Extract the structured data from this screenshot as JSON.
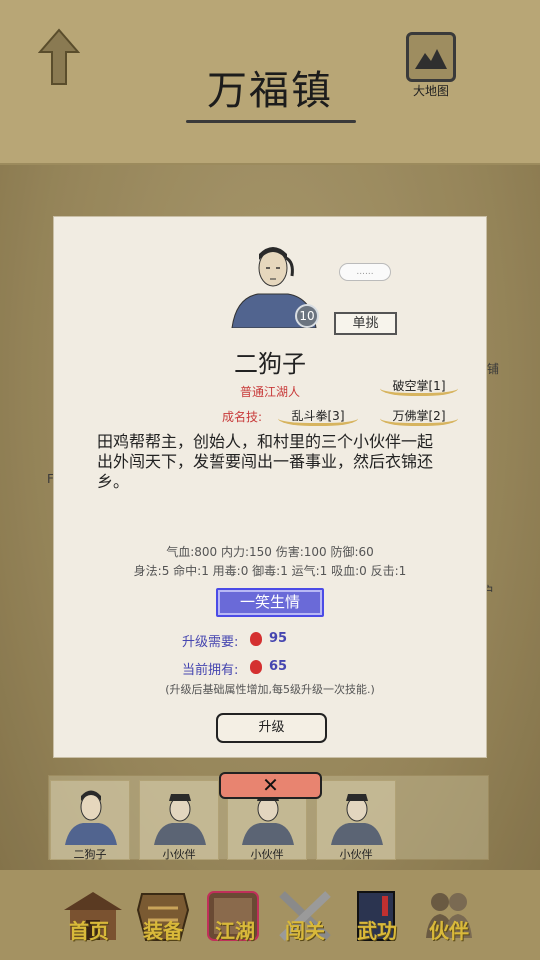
{
  "header": {
    "title": "万福镇",
    "map_label": "大地图"
  },
  "background": {
    "side_texts": [
      "铺",
      "F",
      "户"
    ]
  },
  "character": {
    "name": "二狗子",
    "rank": "普通江湖人",
    "level": "10",
    "bubble": "......",
    "duel_label": "单挑",
    "fame_label": "成名技:",
    "skills": [
      "破空掌[1]",
      "乱斗拳[3]",
      "万佛掌[2]"
    ],
    "description": "田鸡帮帮主，创始人，和村里的三个小伙伴一起出外闯天下，发誓要闯出一番事业，然后衣锦还乡。",
    "stats_line1": "气血:800  内力:150  伤害:100  防御:60",
    "stats_line2": "身法:5  命中:1  用毒:0  御毒:1  运气:1  吸血:0  反击:1",
    "special_skill": "一笑生情",
    "upgrade_need_label": "升级需要:",
    "upgrade_need_value": "95",
    "current_have_label": "当前拥有:",
    "current_have_value": "65",
    "note": "(升级后基础属性增加,每5级升级一次技能.)",
    "upgrade_button": "升级",
    "close_icon": "close-x-icon"
  },
  "partners": [
    {
      "name": "二狗子"
    },
    {
      "name": "小伙伴"
    },
    {
      "name": "小伙伴"
    },
    {
      "name": "小伙伴"
    }
  ],
  "nav": [
    {
      "label": "首页",
      "icon": "house-icon"
    },
    {
      "label": "装备",
      "icon": "armor-icon"
    },
    {
      "label": "江湖",
      "icon": "scroll-icon"
    },
    {
      "label": "闯关",
      "icon": "swords-icon"
    },
    {
      "label": "武功",
      "icon": "book-icon"
    },
    {
      "label": "伙伴",
      "icon": "people-icon"
    }
  ],
  "colors": {
    "accent_blue": "#4646b0",
    "rank_red": "#c83a3a",
    "nav_gold": "#d9b93a",
    "close_red": "#e88470"
  }
}
